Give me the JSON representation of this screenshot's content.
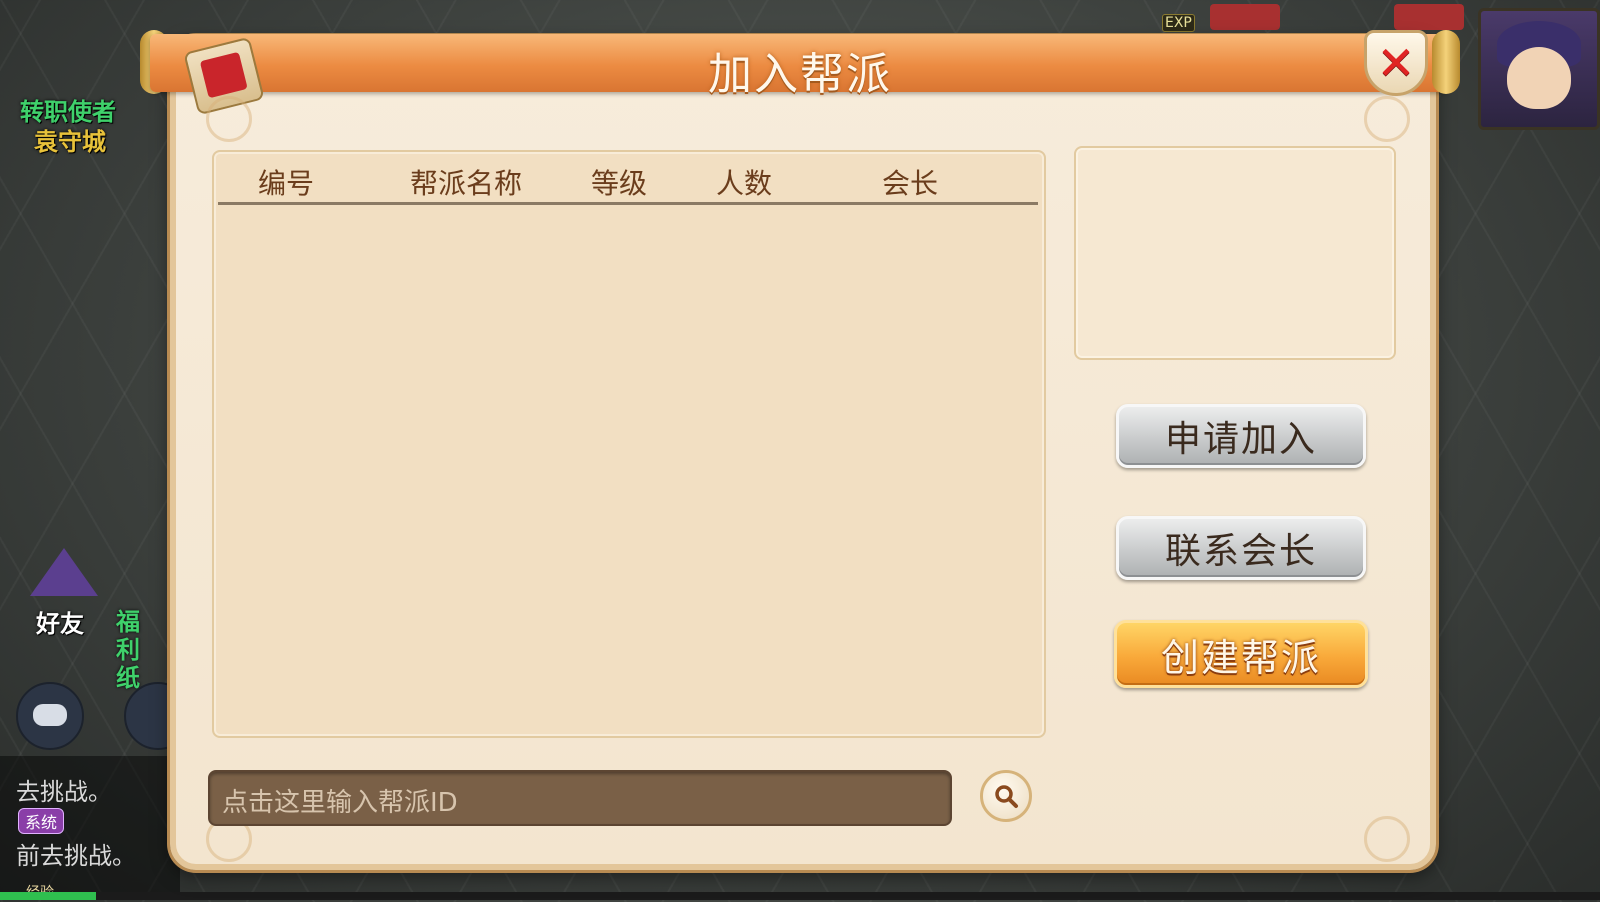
{
  "background": {
    "npc_title": "转职使者",
    "npc_location": "袁守城",
    "friend_label": "好友",
    "welfare_label": "福利纸",
    "chat_line_1": "去挑战。",
    "system_tag": "系统",
    "chat_line_2": "前去挑战。",
    "exp_label": "经验",
    "exp_badge": "EXP",
    "exp_progress": 0.06
  },
  "dialog": {
    "title": "加入帮派",
    "close_icon": "close-x-icon",
    "list": {
      "columns": [
        "编号",
        "帮派名称",
        "等级",
        "人数",
        "会长"
      ],
      "rows": []
    },
    "buttons": {
      "apply": "申请加入",
      "contact": "联系会长",
      "create": "创建帮派"
    },
    "search": {
      "placeholder": "点击这里输入帮派ID",
      "icon": "search-icon"
    }
  },
  "colors": {
    "title_bar": "#ec8b42",
    "create_button": "#f9a93a",
    "close_x": "#e02424",
    "header_text": "#6b3d1c"
  }
}
